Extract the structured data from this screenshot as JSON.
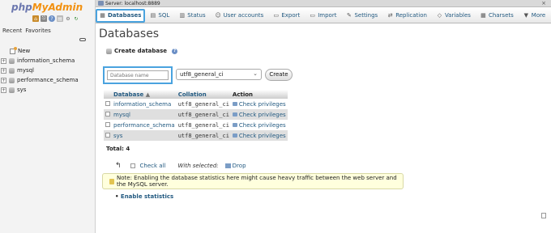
{
  "nav": {
    "logo_php": "php",
    "logo_myadmin": "MyAdmin",
    "tabs": [
      "Recent",
      "Favorites"
    ],
    "tree": [
      {
        "label": "New",
        "expandable": false
      },
      {
        "label": "information_schema",
        "expandable": true
      },
      {
        "label": "mysql",
        "expandable": true
      },
      {
        "label": "performance_schema",
        "expandable": true
      },
      {
        "label": "sys",
        "expandable": true
      }
    ]
  },
  "topbar": {
    "server": "Server: localhost:8889"
  },
  "tabs": [
    {
      "label": "Databases",
      "icon": "database-icon",
      "active": true
    },
    {
      "label": "SQL",
      "icon": "sql-icon"
    },
    {
      "label": "Status",
      "icon": "status-icon"
    },
    {
      "label": "User accounts",
      "icon": "users-icon"
    },
    {
      "label": "Export",
      "icon": "export-icon"
    },
    {
      "label": "Import",
      "icon": "import-icon"
    },
    {
      "label": "Settings",
      "icon": "settings-icon"
    },
    {
      "label": "Replication",
      "icon": "replication-icon"
    },
    {
      "label": "Variables",
      "icon": "variables-icon"
    },
    {
      "label": "Charsets",
      "icon": "charsets-icon"
    },
    {
      "label": "More",
      "icon": "more-icon"
    }
  ],
  "main": {
    "title": "Databases",
    "create_label": "Create database",
    "dbname_placeholder": "Database name",
    "collation": "utf8_general_ci",
    "create_button": "Create",
    "table": {
      "headers": [
        "Database",
        "Collation",
        "Action"
      ],
      "rows": [
        {
          "name": "information_schema",
          "collation": "utf8_general_ci",
          "action": "Check privileges"
        },
        {
          "name": "mysql",
          "collation": "utf8_general_ci",
          "action": "Check privileges"
        },
        {
          "name": "performance_schema",
          "collation": "utf8_general_ci",
          "action": "Check privileges"
        },
        {
          "name": "sys",
          "collation": "utf8_general_ci",
          "action": "Check privileges"
        }
      ]
    },
    "total": "Total: 4",
    "check_all": "Check all",
    "with_selected": "With selected:",
    "drop": "Drop",
    "notice": "Note: Enabling the database statistics here might cause heavy traffic between the web server and the MySQL server.",
    "enable_stats": "Enable statistics"
  },
  "colors": {
    "link": "#235a81",
    "highlight": "#4aa3df",
    "logo_php": "#6c78af",
    "logo_myadmin": "#f29111"
  }
}
